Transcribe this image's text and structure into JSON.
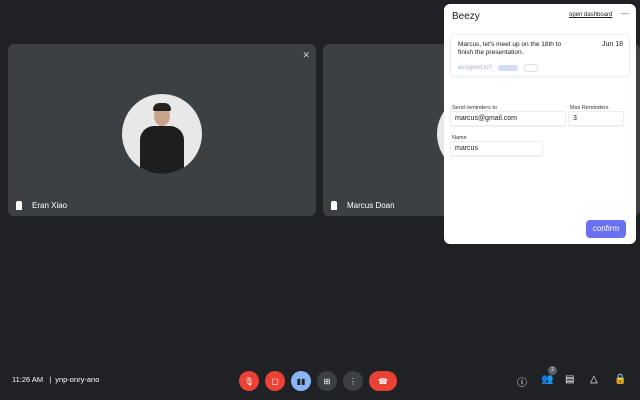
{
  "participants": [
    {
      "name": "Eran Xiao"
    },
    {
      "name": "Marcus Doan"
    }
  ],
  "panel": {
    "title": "Beezy",
    "open_dashboard": "open dashboard",
    "minimize": "—",
    "task": {
      "message": "Marcus, let's meet up on the 18th to finish the presentation.",
      "date": "Jun 18",
      "assigned_label": "assigned to?"
    },
    "reminders_label": "Send reminders to",
    "reminders_value": "marcus@gmail.com",
    "max_label": "Max Reminders",
    "max_value": "3",
    "name_label": "Name",
    "name_value": "marcus",
    "confirm": "confirm"
  },
  "bar": {
    "time": "11:26 AM",
    "separator": "|",
    "meeting_code": "ynp-onry-ano",
    "participants_count": "2"
  },
  "colors": {
    "accent": "#6b70f0",
    "danger": "#ea4335",
    "active": "#8ab4f8"
  }
}
